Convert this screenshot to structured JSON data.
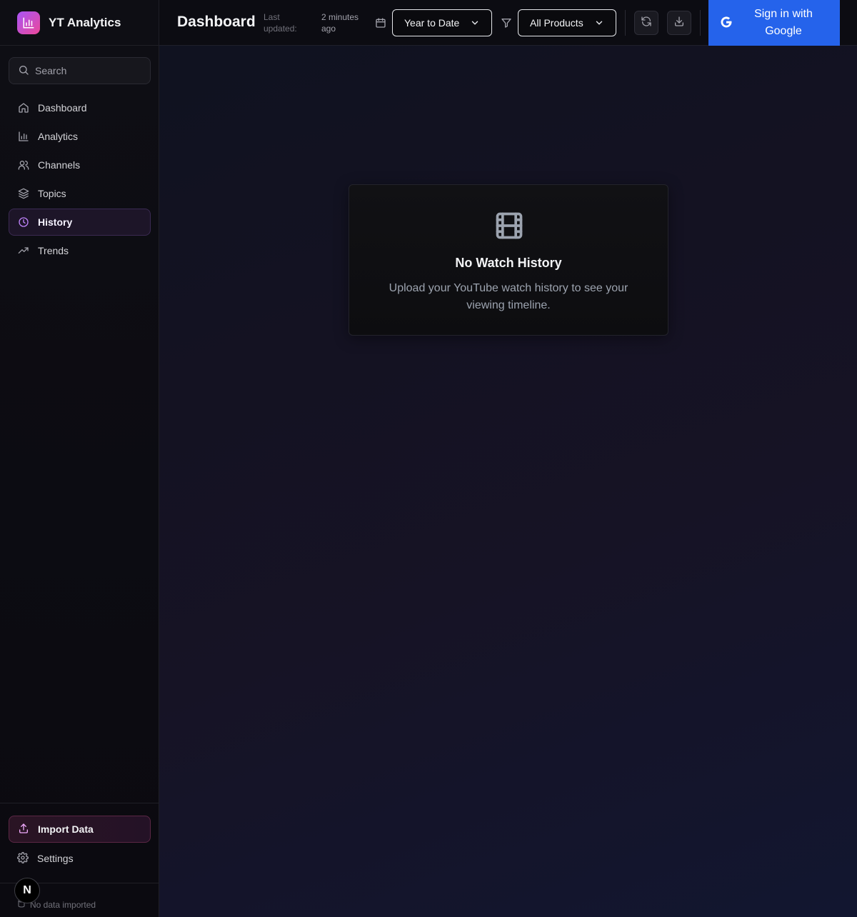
{
  "app": {
    "name": "YT Analytics"
  },
  "sidebar": {
    "search_placeholder": "Search",
    "items": [
      {
        "label": "Dashboard",
        "icon": "home-icon"
      },
      {
        "label": "Analytics",
        "icon": "bar-chart-icon"
      },
      {
        "label": "Channels",
        "icon": "users-icon"
      },
      {
        "label": "Topics",
        "icon": "layers-icon"
      },
      {
        "label": "History",
        "icon": "clock-icon",
        "active": true
      },
      {
        "label": "Trends",
        "icon": "trending-up-icon"
      }
    ],
    "import_label": "Import Data",
    "settings_label": "Settings",
    "status_text": "No data imported"
  },
  "header": {
    "title": "Dashboard",
    "last_updated_label": "Last updated:",
    "last_updated_value": "2 minutes ago",
    "date_range": "Year to Date",
    "product_filter": "All Products",
    "sign_in_label": "Sign in with Google"
  },
  "empty_state": {
    "title": "No Watch History",
    "message": "Upload your YouTube watch history to see your viewing timeline."
  },
  "colors": {
    "accent": "#a855f7",
    "brand_pink": "#ec4899",
    "google_blue": "#2563eb"
  }
}
